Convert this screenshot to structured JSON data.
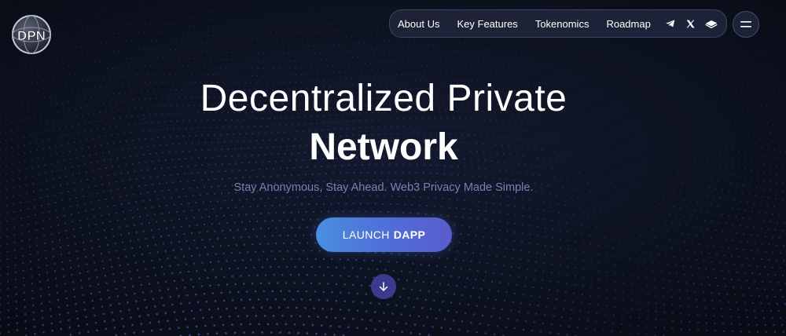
{
  "brand": {
    "logo_text": "DPN"
  },
  "nav": {
    "links": [
      {
        "label": "About Us"
      },
      {
        "label": "Key Features"
      },
      {
        "label": "Tokenomics"
      },
      {
        "label": "Roadmap"
      }
    ],
    "social_icons": [
      "telegram-icon",
      "x-icon",
      "gitbook-icon"
    ],
    "menu_icon": "hamburger-icon"
  },
  "hero": {
    "title_line1": "Decentralized Private",
    "title_line2": "Network",
    "subtitle": "Stay Anonymous, Stay Ahead. Web3 Privacy Made Simple.",
    "cta_prefix": "LAUNCH",
    "cta_bold": "DAPP",
    "scroll_icon": "arrow-down-icon"
  },
  "colors": {
    "background": "#0b0e18",
    "dots": "#4a5fb0",
    "subtitle": "#7c7fb3",
    "cta_start": "#4a8fe0",
    "cta_end": "#5a5ccb",
    "scroll_button": "#3b3b8e"
  }
}
